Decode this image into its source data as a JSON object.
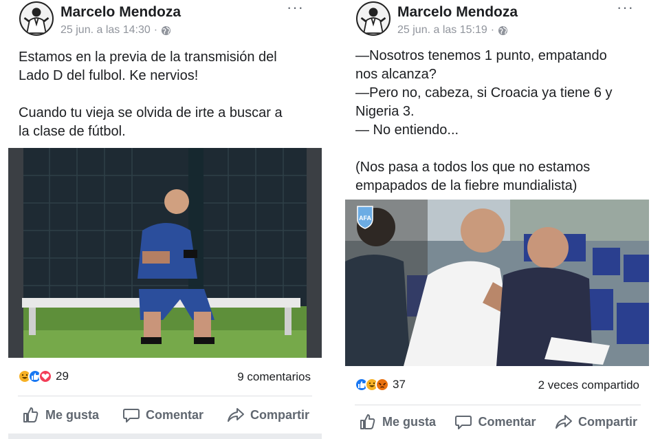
{
  "posts": [
    {
      "author": "Marcelo Mendoza",
      "timestamp": "25 jun. a las 14:30",
      "separator": "·",
      "more": "···",
      "text": "Estamos en la previa de la transmisión del\nLado D del fulbol. Ke nervios!\n\nCuando tu vieja se olvida de irte a buscar a\nla clase de fútbol.",
      "reactions": [
        "haha",
        "like",
        "love"
      ],
      "reaction_count": "29",
      "stat": "9 comentarios",
      "actions": {
        "like": "Me gusta",
        "comment": "Comentar",
        "share": "Compartir"
      }
    },
    {
      "author": "Marcelo Mendoza",
      "timestamp": "25 jun. a las 15:19",
      "separator": "·",
      "more": "···",
      "text": "—Nosotros tenemos 1 punto, empatando\nnos alcanza?\n—Pero no, cabeza, si Croacia ya tiene 6 y\nNigeria 3.\n— No entiendo...\n\n(Nos pasa a todos los que no estamos\nempapados de la fiebre mundialista)",
      "reactions": [
        "like",
        "haha",
        "angry"
      ],
      "reaction_count": "37",
      "stat": "2 veces compartido",
      "actions": {
        "like": "Me gusta",
        "comment": "Comentar",
        "share": "Compartir"
      }
    }
  ],
  "icons": {
    "like_color": "#1877f2",
    "love_color": "#f33e58",
    "haha_color": "#f7b125",
    "angry_color": "#e9710f"
  }
}
